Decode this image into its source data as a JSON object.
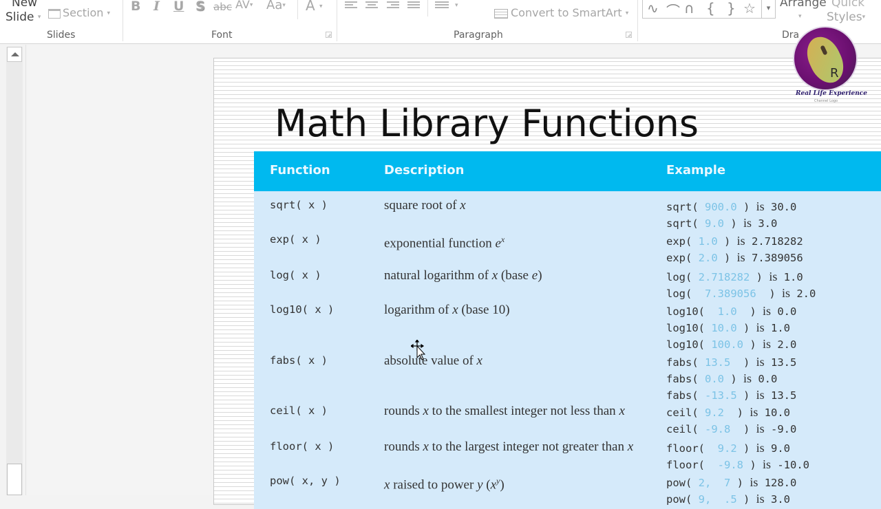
{
  "ribbon": {
    "slides_group": {
      "new_slide_top": "New",
      "new_slide_bottom": "Slide",
      "section_label": "Section",
      "group_label": "Slides"
    },
    "font_group": {
      "bold": "B",
      "italic": "I",
      "underline": "U",
      "shadow": "S",
      "strikethrough": "abc",
      "char_spacing": "AV",
      "change_case": "Aa",
      "font_color": "A",
      "group_label": "Font"
    },
    "paragraph_group": {
      "convert_smartart": "Convert to SmartArt",
      "group_label": "Paragraph"
    },
    "drawing_group": {
      "shapes": [
        "freeform-scribble",
        "arc",
        "curve",
        "left-brace",
        "right-brace",
        "star"
      ],
      "arrange_label": "Arrange",
      "quick_styles_top": "Quick",
      "quick_styles_bottom": "Styles",
      "group_label": "Dra"
    }
  },
  "logo": {
    "letter": "R",
    "text": "Real Life Experience",
    "subtext": "Channel Logo"
  },
  "slide": {
    "title": "Math Library Functions",
    "table": {
      "header_color": "#00b9ef",
      "body_color": "#d5eafa",
      "arg_color": "#7cc3e6",
      "headers": [
        "Function",
        "Description",
        "Example"
      ],
      "rows": [
        {
          "function": "sqrt( x )",
          "description": [
            {
              "t": "square root of "
            },
            {
              "i": "x"
            }
          ],
          "examples": [
            {
              "pre": "sqrt( ",
              "arg": "900.0",
              "post": " ) ",
              "is": "is",
              "result": " 30.0"
            },
            {
              "pre": "sqrt( ",
              "arg": "9.0",
              "post": " ) ",
              "is": "is",
              "result": " 3.0"
            }
          ]
        },
        {
          "function": "exp( x )",
          "description": [
            {
              "t": "exponential function "
            },
            {
              "i": "e"
            },
            {
              "sup": "x"
            }
          ],
          "examples": [
            {
              "pre": "exp( ",
              "arg": "1.0",
              "post": " ) ",
              "is": "is",
              "result": " 2.718282"
            },
            {
              "pre": "exp( ",
              "arg": "2.0",
              "post": " ) ",
              "is": "is",
              "result": " 7.389056"
            }
          ]
        },
        {
          "function": "log( x )",
          "description": [
            {
              "t": "natural logarithm of "
            },
            {
              "i": "x"
            },
            {
              "t": " (base "
            },
            {
              "i": "e"
            },
            {
              "t": ")"
            }
          ],
          "examples": [
            {
              "pre": "log( ",
              "arg": "2.718282",
              "post": " ) ",
              "is": "is",
              "result": " 1.0"
            },
            {
              "pre": "log(  ",
              "arg": "7.389056",
              "post": "  ) ",
              "is": "is",
              "result": " 2.0"
            }
          ]
        },
        {
          "function": "log10( x )",
          "description": [
            {
              "t": "logarithm of "
            },
            {
              "i": "x"
            },
            {
              "t": " (base 10)"
            }
          ],
          "examples": [
            {
              "pre": "log10(  ",
              "arg": "1.0",
              "post": "  ) ",
              "is": "is",
              "result": " 0.0"
            },
            {
              "pre": "log10( ",
              "arg": "10.0",
              "post": " ) ",
              "is": "is",
              "result": " 1.0"
            },
            {
              "pre": "log10( ",
              "arg": "100.0",
              "post": " ) ",
              "is": "is",
              "result": " 2.0"
            }
          ]
        },
        {
          "function": "fabs( x )",
          "description": [
            {
              "t": "absolute value of "
            },
            {
              "i": "x"
            }
          ],
          "examples": [
            {
              "pre": "fabs( ",
              "arg": "13.5",
              "post": "  ) ",
              "is": "is",
              "result": " 13.5"
            },
            {
              "pre": "fabs( ",
              "arg": "0.0",
              "post": " ) ",
              "is": "is",
              "result": " 0.0"
            },
            {
              "pre": "fabs( ",
              "arg": "-13.5",
              "post": " ) ",
              "is": "is",
              "result": " 13.5"
            }
          ]
        },
        {
          "function": "ceil( x )",
          "description": [
            {
              "t": "rounds "
            },
            {
              "i": "x"
            },
            {
              "t": " to the smallest integer not less than "
            },
            {
              "i": "x"
            }
          ],
          "examples": [
            {
              "pre": "ceil( ",
              "arg": "9.2",
              "post": "  ) ",
              "is": "is",
              "result": " 10.0"
            },
            {
              "pre": "ceil( ",
              "arg": "-9.8",
              "post": "  ) ",
              "is": "is",
              "result": " -9.0"
            }
          ]
        },
        {
          "function": "floor( x )",
          "description": [
            {
              "t": "rounds "
            },
            {
              "i": "x"
            },
            {
              "t": " to the largest  integer not greater than "
            },
            {
              "i": "x"
            }
          ],
          "examples": [
            {
              "pre": "floor(  ",
              "arg": "9.2",
              "post": " ) ",
              "is": "is",
              "result": " 9.0"
            },
            {
              "pre": "floor(  ",
              "arg": "-9.8",
              "post": " ) ",
              "is": "is",
              "result": " -10.0"
            }
          ]
        },
        {
          "function": "pow( x, y )",
          "description": [
            {
              "i": "x"
            },
            {
              "t": " raised to power "
            },
            {
              "i": "y"
            },
            {
              "t": " ("
            },
            {
              "i": "x"
            },
            {
              "sup": "y"
            },
            {
              "t": ")"
            }
          ],
          "examples": [
            {
              "pre": "pow( ",
              "arg": "2,  7",
              "post": " ) ",
              "is": "is",
              "result": " 128.0"
            },
            {
              "pre": "pow( ",
              "arg": "9,  .5",
              "post": " ) ",
              "is": "is",
              "result": " 3.0"
            }
          ]
        }
      ]
    }
  }
}
